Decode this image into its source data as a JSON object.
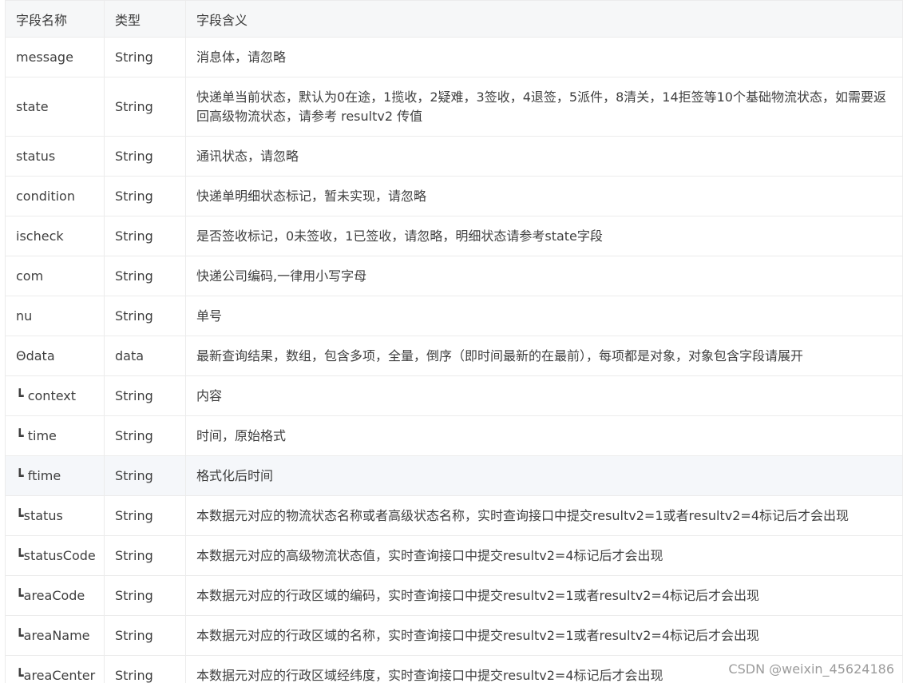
{
  "table": {
    "headers": [
      "字段名称",
      "类型",
      "字段含义"
    ],
    "rows": [
      {
        "name": "message",
        "type": "String",
        "desc": "消息体，请忽略"
      },
      {
        "name": "state",
        "type": "String",
        "desc": "快递单当前状态，默认为0在途，1揽收，2疑难，3签收，4退签，5派件，8清关，14拒签等10个基础物流状态，如需要返回高级物流状态，请参考 resultv2 传值"
      },
      {
        "name": "status",
        "type": "String",
        "desc": "通讯状态，请忽略"
      },
      {
        "name": "condition",
        "type": "String",
        "desc": "快递单明细状态标记，暂未实现，请忽略"
      },
      {
        "name": "ischeck",
        "type": "String",
        "desc": "是否签收标记，0未签收，1已签收，请忽略，明细状态请参考state字段"
      },
      {
        "name": "com",
        "type": "String",
        "desc": "快递公司编码,一律用小写字母"
      },
      {
        "name": "nu",
        "type": "String",
        "desc": "单号"
      },
      {
        "name": "Θdata",
        "type": "data",
        "desc": "最新查询结果，数组，包含多项，全量，倒序（即时间最新的在最前），每项都是对象，对象包含字段请展开"
      },
      {
        "name": "┗ context",
        "type": "String",
        "desc": "内容"
      },
      {
        "name": "┗ time",
        "type": "String",
        "desc": "时间，原始格式"
      },
      {
        "name": "┗ ftime",
        "type": "String",
        "desc": "格式化后时间"
      },
      {
        "name": "┗status",
        "type": "String",
        "desc": "本数据元对应的物流状态名称或者高级状态名称，实时查询接口中提交resultv2=1或者resultv2=4标记后才会出现"
      },
      {
        "name": "┗statusCode",
        "type": "String",
        "desc": "本数据元对应的高级物流状态值，实时查询接口中提交resultv2=4标记后才会出现"
      },
      {
        "name": "┗areaCode",
        "type": "String",
        "desc": "本数据元对应的行政区域的编码，实时查询接口中提交resultv2=1或者resultv2=4标记后才会出现"
      },
      {
        "name": "┗areaName",
        "type": "String",
        "desc": "本数据元对应的行政区域的名称，实时查询接口中提交resultv2=1或者resultv2=4标记后才会出现"
      },
      {
        "name": "┗areaCenter",
        "type": "String",
        "desc": "本数据元对应的行政区域经纬度，实时查询接口中提交resultv2=4标记后才会出现"
      }
    ]
  },
  "watermark": "CSDN @weixin_45624186"
}
